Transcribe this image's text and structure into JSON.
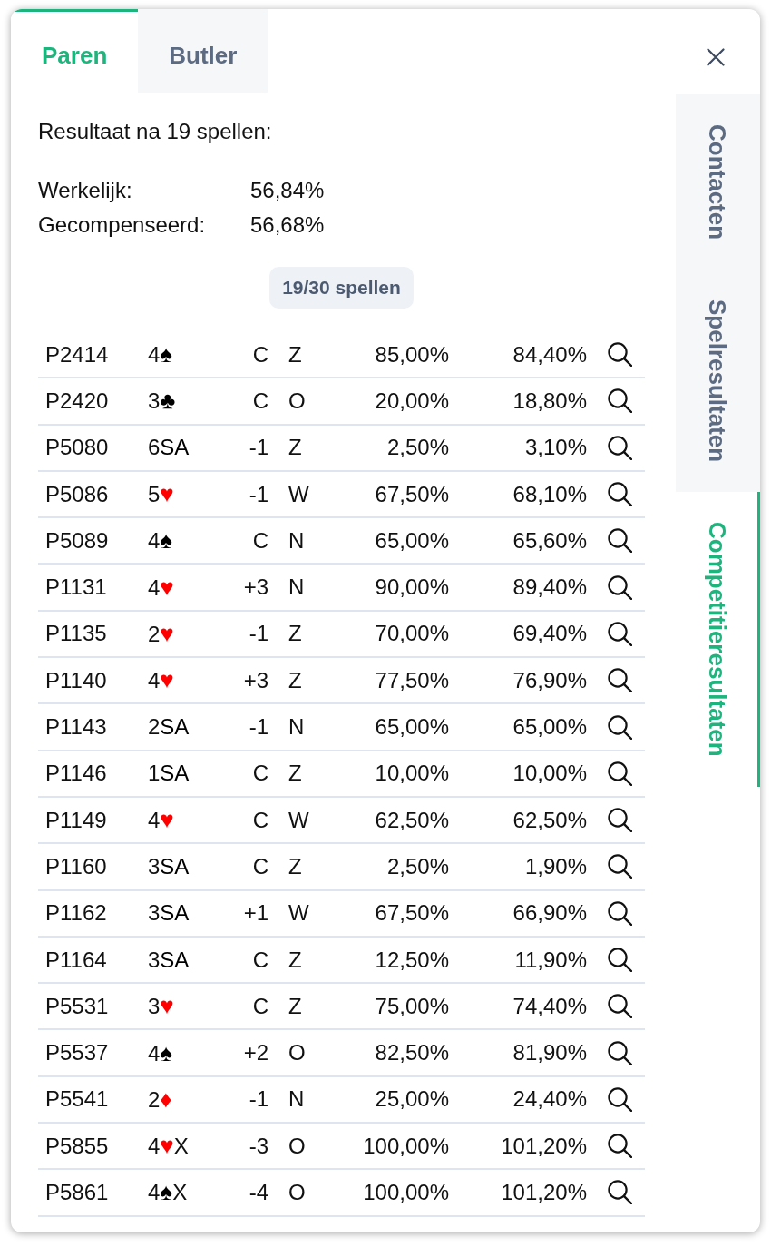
{
  "top_tabs": [
    {
      "label": "Paren",
      "selected": true
    },
    {
      "label": "Butler",
      "selected": false
    }
  ],
  "side_tabs": [
    {
      "label": "Contacten",
      "selected": false
    },
    {
      "label": "Spelresultaten",
      "selected": false
    },
    {
      "label": "Competitieresultaten",
      "selected": true
    }
  ],
  "summary": {
    "heading": "Resultaat na 19 spellen:",
    "stats": [
      {
        "label": "Werkelijk:",
        "value": "56,84%"
      },
      {
        "label": "Gecompenseerd:",
        "value": "56,68%"
      }
    ]
  },
  "progress_badge": "19/30 spellen",
  "table": {
    "rows": [
      {
        "column_1": "P2414",
        "column_2": {
          "level": "4",
          "strain": "♠",
          "color": "#000000"
        },
        "column_3": "C",
        "column_4": "Z",
        "column_5": "85,00%",
        "column_6": "84,40%"
      },
      {
        "column_1": "P2420",
        "column_2": {
          "level": "3",
          "strain": "♣",
          "color": "#000000"
        },
        "column_3": "C",
        "column_4": "O",
        "column_5": "20,00%",
        "column_6": "18,80%"
      },
      {
        "column_1": "P5080",
        "column_2": {
          "level": "6",
          "strain": "SA",
          "color": "#000000"
        },
        "column_3": "-1",
        "column_4": "Z",
        "column_5": "2,50%",
        "column_6": "3,10%"
      },
      {
        "column_1": "P5086",
        "column_2": {
          "level": "5",
          "strain": "♥",
          "color": "#ff0000"
        },
        "column_3": "-1",
        "column_4": "W",
        "column_5": "67,50%",
        "column_6": "68,10%"
      },
      {
        "column_1": "P5089",
        "column_2": {
          "level": "4",
          "strain": "♠",
          "color": "#000000"
        },
        "column_3": "C",
        "column_4": "N",
        "column_5": "65,00%",
        "column_6": "65,60%"
      },
      {
        "column_1": "P1131",
        "column_2": {
          "level": "4",
          "strain": "♥",
          "color": "#ff0000"
        },
        "column_3": "+3",
        "column_4": "N",
        "column_5": "90,00%",
        "column_6": "89,40%"
      },
      {
        "column_1": "P1135",
        "column_2": {
          "level": "2",
          "strain": "♥",
          "color": "#ff0000"
        },
        "column_3": "-1",
        "column_4": "Z",
        "column_5": "70,00%",
        "column_6": "69,40%"
      },
      {
        "column_1": "P1140",
        "column_2": {
          "level": "4",
          "strain": "♥",
          "color": "#ff0000"
        },
        "column_3": "+3",
        "column_4": "Z",
        "column_5": "77,50%",
        "column_6": "76,90%"
      },
      {
        "column_1": "P1143",
        "column_2": {
          "level": "2",
          "strain": "SA",
          "color": "#000000"
        },
        "column_3": "-1",
        "column_4": "N",
        "column_5": "65,00%",
        "column_6": "65,00%"
      },
      {
        "column_1": "P1146",
        "column_2": {
          "level": "1",
          "strain": "SA",
          "color": "#000000"
        },
        "column_3": "C",
        "column_4": "Z",
        "column_5": "10,00%",
        "column_6": "10,00%"
      },
      {
        "column_1": "P1149",
        "column_2": {
          "level": "4",
          "strain": "♥",
          "color": "#ff0000"
        },
        "column_3": "C",
        "column_4": "W",
        "column_5": "62,50%",
        "column_6": "62,50%"
      },
      {
        "column_1": "P1160",
        "column_2": {
          "level": "3",
          "strain": "SA",
          "color": "#000000"
        },
        "column_3": "C",
        "column_4": "Z",
        "column_5": "2,50%",
        "column_6": "1,90%"
      },
      {
        "column_1": "P1162",
        "column_2": {
          "level": "3",
          "strain": "SA",
          "color": "#000000"
        },
        "column_3": "+1",
        "column_4": "W",
        "column_5": "67,50%",
        "column_6": "66,90%"
      },
      {
        "column_1": "P1164",
        "column_2": {
          "level": "3",
          "strain": "SA",
          "color": "#000000"
        },
        "column_3": "C",
        "column_4": "Z",
        "column_5": "12,50%",
        "column_6": "11,90%"
      },
      {
        "column_1": "P5531",
        "column_2": {
          "level": "3",
          "strain": "♥",
          "color": "#ff0000"
        },
        "column_3": "C",
        "column_4": "Z",
        "column_5": "75,00%",
        "column_6": "74,40%"
      },
      {
        "column_1": "P5537",
        "column_2": {
          "level": "4",
          "strain": "♠",
          "color": "#000000"
        },
        "column_3": "+2",
        "column_4": "O",
        "column_5": "82,50%",
        "column_6": "81,90%"
      },
      {
        "column_1": "P5541",
        "column_2": {
          "level": "2",
          "strain": "♦",
          "color": "#ff0000"
        },
        "column_3": "-1",
        "column_4": "N",
        "column_5": "25,00%",
        "column_6": "24,40%"
      },
      {
        "column_1": "P5855",
        "column_2": {
          "level": "4",
          "strain": "♥",
          "color": "#ff0000",
          "doubled": "X"
        },
        "column_3": "-3",
        "column_4": "O",
        "column_5": "100,00%",
        "column_6": "101,20%"
      },
      {
        "column_1": "P5861",
        "column_2": {
          "level": "4",
          "strain": "♠",
          "color": "#000000",
          "doubled": "X"
        },
        "column_3": "-4",
        "column_4": "O",
        "column_5": "100,00%",
        "column_6": "101,20%"
      }
    ]
  }
}
